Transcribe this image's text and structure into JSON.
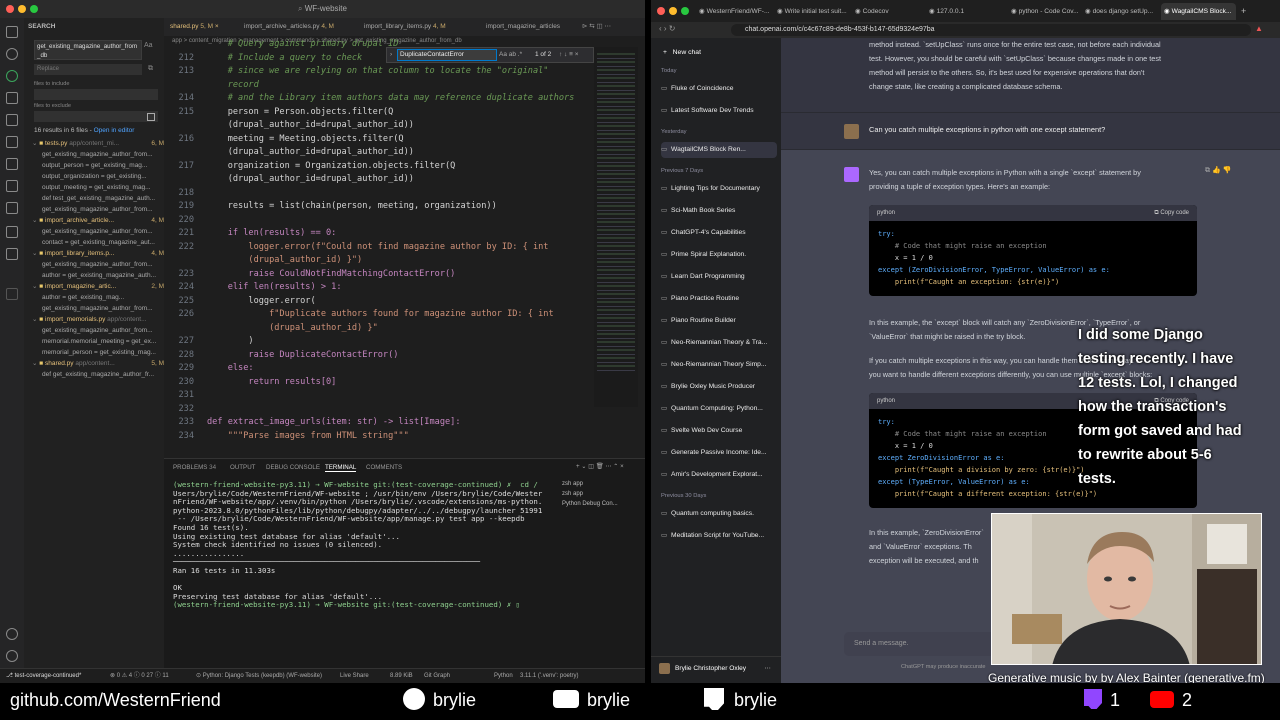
{
  "vscode": {
    "window_title": "WF-website",
    "tabs": [
      {
        "label": "shared.py",
        "badge": "5, M"
      },
      {
        "label": "import_archive_articles.py",
        "badge": "4, M"
      },
      {
        "label": "import_library_items.py",
        "badge": "4, M"
      },
      {
        "label": "import_magazine_articles",
        "badge": ""
      }
    ],
    "breadcrumb": "app > content_migration > management > commands > shared.py > get_existing_magazine_author_from_db",
    "sidebar": {
      "title": "SEARCH",
      "search_value": "get_existing_magazine_author_from_db",
      "replace_placeholder": "Replace",
      "files_include_label": "files to include",
      "files_exclude_label": "files to exclude",
      "result_summary": "16 results in 6 files - ",
      "open_in_editor": "Open in editor",
      "results": [
        {
          "type": "file",
          "name": "tests.py",
          "path": "app/content_mi...",
          "badge": "6, M"
        },
        {
          "type": "match",
          "text": "get_existing_magazine_author_from..."
        },
        {
          "type": "match",
          "text": "output_person = get_existing_mag..."
        },
        {
          "type": "match",
          "text": "output_organization = get_existing..."
        },
        {
          "type": "match",
          "text": "output_meeting = get_existing_mag..."
        },
        {
          "type": "match",
          "text": "def test_get_existing_magazine_auth..."
        },
        {
          "type": "match",
          "text": "get_existing_magazine_author_from..."
        },
        {
          "type": "file",
          "name": "import_archive_article...",
          "path": "",
          "badge": "4, M"
        },
        {
          "type": "match",
          "text": "get_existing_magazine_author_from..."
        },
        {
          "type": "match",
          "text": "contact = get_existing_magazine_aut..."
        },
        {
          "type": "file",
          "name": "import_library_items.p...",
          "path": "",
          "badge": "4, M"
        },
        {
          "type": "match",
          "text": "get_existing_magazine_author_from..."
        },
        {
          "type": "match",
          "text": "author = get_existing_magazine_auth..."
        },
        {
          "type": "file",
          "name": "import_magazine_artic...",
          "path": "",
          "badge": "2, M"
        },
        {
          "type": "match",
          "text": "author = get_existing_mag..."
        },
        {
          "type": "match",
          "text": "get_existing_magazine_author_from..."
        },
        {
          "type": "file",
          "name": "import_memorials.py",
          "path": "app/content...",
          "badge": ""
        },
        {
          "type": "match",
          "text": "get_existing_magazine_author_from..."
        },
        {
          "type": "match",
          "text": "memorial.memorial_meeting = get_ex..."
        },
        {
          "type": "match",
          "text": "memorial_person = get_existing_mag..."
        },
        {
          "type": "file",
          "name": "shared.py",
          "path": "app/content...",
          "badge": "5, M"
        },
        {
          "type": "match",
          "text": "def get_existing_magazine_author_fr..."
        }
      ]
    },
    "find": {
      "value": "DuplicateContactError",
      "options": "Aa ab .*",
      "count": "1 of 2"
    },
    "code_lines": [
      {
        "n": "",
        "t": "    # Query against primary drupal ID",
        "c": "cm"
      },
      {
        "n": "212",
        "t": "    # Include a query to check",
        "c": "cm"
      },
      {
        "n": "213",
        "t": "    # since we are relying on that column to locate the \"original\"",
        "c": "cm"
      },
      {
        "n": "",
        "t": "    record",
        "c": "cm"
      },
      {
        "n": "214",
        "t": "    # and the Library item authors data may reference duplicate authors",
        "c": "cm"
      },
      {
        "n": "215",
        "t": "    person = Person.objects.filter(Q",
        "c": ""
      },
      {
        "n": "",
        "t": "    (drupal_author_id=drupal_author_id))",
        "c": ""
      },
      {
        "n": "216",
        "t": "    meeting = Meeting.objects.filter(Q",
        "c": ""
      },
      {
        "n": "",
        "t": "    (drupal_author_id=drupal_author_id))",
        "c": ""
      },
      {
        "n": "217",
        "t": "    organization = Organization.objects.filter(Q",
        "c": ""
      },
      {
        "n": "",
        "t": "    (drupal_author_id=drupal_author_id))",
        "c": ""
      },
      {
        "n": "218",
        "t": "",
        "c": ""
      },
      {
        "n": "219",
        "t": "    results = list(chain(person, meeting, organization))",
        "c": ""
      },
      {
        "n": "220",
        "t": "",
        "c": ""
      },
      {
        "n": "221",
        "t": "    if len(results) == 0:",
        "c": ""
      },
      {
        "n": "222",
        "t": "        logger.error(f\"Could not find magazine author by ID: { int",
        "c": ""
      },
      {
        "n": "",
        "t": "        (drupal_author_id) }\")",
        "c": ""
      },
      {
        "n": "223",
        "t": "        raise CouldNotFindMatchingContactError()",
        "c": ""
      },
      {
        "n": "224",
        "t": "    elif len(results) > 1:",
        "c": ""
      },
      {
        "n": "225",
        "t": "        logger.error(",
        "c": ""
      },
      {
        "n": "226",
        "t": "            f\"Duplicate authors found for magazine author ID: { int",
        "c": ""
      },
      {
        "n": "",
        "t": "            (drupal_author_id) }\"",
        "c": ""
      },
      {
        "n": "227",
        "t": "        )",
        "c": ""
      },
      {
        "n": "228",
        "t": "        raise DuplicateContactError()",
        "c": ""
      },
      {
        "n": "229",
        "t": "    else:",
        "c": ""
      },
      {
        "n": "230",
        "t": "        return results[0]",
        "c": ""
      },
      {
        "n": "231",
        "t": "",
        "c": ""
      },
      {
        "n": "232",
        "t": "",
        "c": ""
      },
      {
        "n": "233",
        "t": "def extract_image_urls(item: str) -> list[Image]:",
        "c": ""
      },
      {
        "n": "234",
        "t": "    \"\"\"Parse images from HTML string\"\"\"",
        "c": ""
      }
    ],
    "terminal": {
      "tabs": [
        "PROBLEMS",
        "OUTPUT",
        "DEBUG CONSOLE",
        "TERMINAL",
        "COMMENTS"
      ],
      "problems_count": "34",
      "active_tab": "TERMINAL",
      "sessions": [
        "zsh app",
        "zsh app",
        "Python Debug Con..."
      ],
      "lines": [
        "(western-friend-website-py3.11) → WF-website git:(test-coverage-continued) ✗  cd /",
        "Users/brylie/Code/WesternFriend/WF-website ; /usr/bin/env /Users/brylie/Code/Wester",
        "nFriend/WF-website/app/.venv/bin/python /Users/brylie/.vscode/extensions/ms-python.",
        "python-2023.8.0/pythonFiles/lib/python/debugpy/adapter/../../debugpy/launcher 51991",
        " -- /Users/brylie/Code/WesternFriend/WF-website/app/manage.py test app --keepdb",
        "Found 16 test(s).",
        "Using existing test database for alias 'default'...",
        "System check identified no issues (0 silenced).",
        "................",
        "─────────────────────────────────────────────────────────────────────",
        "Ran 16 tests in 11.303s",
        "",
        "OK",
        "Preserving test database for alias 'default'...",
        "(western-friend-website-py3.11) → WF-website git:(test-coverage-continued) ✗ ▯"
      ]
    },
    "status": {
      "branch": "test-coverage-continued*",
      "problems": "⊗ 0 ⚠ 4  ⓘ 0 27  ⓘ 11",
      "debug": "⊙ Python: Django Tests (keepdb) (WF-website)",
      "live_share": "Live Share",
      "size": "8.89 KiB",
      "git_graph": "Git Graph",
      "language": "Python",
      "python_version": "3.11.1 ('.venv': poetry)"
    }
  },
  "browser": {
    "tabs": [
      "WesternFriend/WF-...",
      "Write initial test suit...",
      "Codecov",
      "127.0.0.1",
      "python - Code Cov...",
      "does django setUp...",
      "WagtailCMS Block..."
    ],
    "url": "chat.openai.com/c/c4c67c89-de8b-453f-b147-65d9324e97ba"
  },
  "chatgpt": {
    "new_chat": "New chat",
    "sections": [
      {
        "title": "Today",
        "items": [
          "Fluke of Coincidence",
          "Latest Software Dev Trends"
        ]
      },
      {
        "title": "Yesterday",
        "items": [
          "WagtailCMS Block Ren..."
        ]
      },
      {
        "title": "Previous 7 Days",
        "items": [
          "Lighting Tips for Documentary",
          "Sci-Math Book Series",
          "ChatGPT-4's Capabilities",
          "Prime Spiral Explanation.",
          "Learn Dart Programming",
          "Piano Practice Routine",
          "Piano Routine Builder",
          "Neo-Riemannian Theory & Tra...",
          "Neo-Riemannian Theory Simp...",
          "Brylie Oxley Music Producer",
          "Quantum Computing: Python...",
          "Svelte Web Dev Course",
          "Generate Passive Income: Ide...",
          "Amir's Development Explorat..."
        ]
      },
      {
        "title": "Previous 30 Days",
        "items": [
          "Quantum computing basics.",
          "Meditation Script for YouTube..."
        ]
      }
    ],
    "user_name": "Brylie Christopher Oxley",
    "prev_answer": [
      "method instead. `setUpClass` runs once for the entire test case, not before each individual",
      "test. However, you should be careful with `setUpClass` because changes made in one test",
      "method will persist to the others. So, it's best used for expensive operations that don't",
      "change state, like creating a complicated database schema."
    ],
    "user_question": "Can you catch multiple exceptions in python with one except statement?",
    "answer_intro": [
      "Yes, you can catch multiple exceptions in Python with a single `except` statement by",
      "providing a tuple of exception types. Here's an example:"
    ],
    "code_lang": "python",
    "copy_label": "Copy code",
    "code1": [
      "try:",
      "    # Code that might raise an exception",
      "    x = 1 / 0",
      "except (ZeroDivisionError, TypeError, ValueError) as e:",
      "    print(f\"Caught an exception: {str(e)}\")"
    ],
    "para2": [
      "In this example, the `except` block will catch any `ZeroDivisionError`, `TypeError`, or",
      "`ValueError` that might be raised in the try block."
    ],
    "para3": [
      "If you catch multiple exceptions in this way, you can handle them in the same way. If",
      "you want to handle different exceptions differently, you can use multiple `except` blocks:"
    ],
    "code2": [
      "try:",
      "    # Code that might raise an exception",
      "    x = 1 / 0",
      "except ZeroDivisionError as e:",
      "    print(f\"Caught a division by zero: {str(e)}\")",
      "except (TypeError, ValueError) as e:",
      "    print(f\"Caught a different exception: {str(e)}\")"
    ],
    "para4": [
      "In this example, `ZeroDivisionError`",
      "and `ValueError` exceptions. Th",
      "exception will be executed, and th"
    ],
    "send_placeholder": "Send a message.",
    "disclaimer": "ChatGPT may produce inaccurate"
  },
  "overlay": {
    "caption": [
      "I did some Django",
      "testing recently. I have",
      "12 tests. Lol, I changed",
      "how the transaction's",
      "form got saved and had",
      "to rewrite about 5-6",
      "tests."
    ],
    "music_credit": "Generative music by by Alex Bainter (generative.fm)",
    "github": "github.com/WesternFriend",
    "github_user": "brylie",
    "youtube_user": "brylie",
    "twitch_user": "brylie",
    "twitch_count": "1",
    "youtube_count": "2"
  }
}
